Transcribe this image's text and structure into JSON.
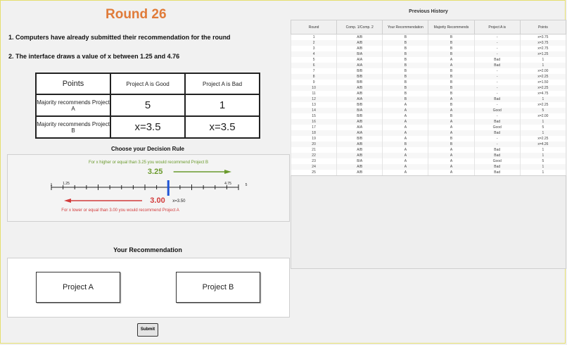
{
  "title": "Round   26",
  "instructions": [
    "1. Computers have already submitted their recommendation for the round",
    "2. The interface draws a value of x between 1.25 and 4.76"
  ],
  "points_table": {
    "header": [
      "Points",
      "Project A is Good",
      "Project A is Bad"
    ],
    "rows": [
      {
        "label": "Majority recommends Project A",
        "good": "5",
        "bad": "1"
      },
      {
        "label": "Majority recommends Project B",
        "good": "x=3.5",
        "bad": "x=3.5"
      }
    ]
  },
  "decision_rule": {
    "heading": "Choose your Decision Rule",
    "upper_text": "For x higher or equal than 3.25 you would recommend Project B",
    "lower_text": "For x lower or equal than 3.00 you would recommend Project A",
    "upper_value": "3.25",
    "lower_value": "3.00",
    "x_marker_label": "x=3.50",
    "tick_min": "1",
    "tick_low": "1.25",
    "tick_high": "4.75",
    "tick_max": "5",
    "axis_min": 1,
    "axis_max": 5,
    "upper_threshold": 3.25,
    "lower_threshold": 3.0,
    "x_value": 3.5,
    "colors": {
      "upper": "#6a9a2c",
      "lower": "#d23b3b",
      "marker": "#1f54d6"
    }
  },
  "recommendation": {
    "heading": "Your Recommendation",
    "option_a": "Project A",
    "option_b": "Project B"
  },
  "submit_label": "Submit",
  "history": {
    "title": "Previous History",
    "columns": [
      "Round",
      "Comp. 1/Comp. 2",
      "Your Recommendation",
      "Majority Recommends",
      "Project A is",
      "Points"
    ],
    "rows": [
      [
        "1",
        "A/B",
        "B",
        "B",
        "-",
        "x=3.75"
      ],
      [
        "2",
        "A/B",
        "B",
        "B",
        "-",
        "x=3.75"
      ],
      [
        "3",
        "A/B",
        "B",
        "B",
        "-",
        "x=2.75"
      ],
      [
        "4",
        "B/A",
        "B",
        "B",
        "-",
        "x=1.25"
      ],
      [
        "5",
        "A/A",
        "B",
        "A",
        "Bad",
        "1"
      ],
      [
        "6",
        "A/A",
        "B",
        "A",
        "Bad",
        "1"
      ],
      [
        "7",
        "B/B",
        "B",
        "B",
        "-",
        "x=2.00"
      ],
      [
        "8",
        "B/B",
        "B",
        "B",
        "-",
        "x=2.25"
      ],
      [
        "9",
        "B/B",
        "B",
        "B",
        "-",
        "x=1.50"
      ],
      [
        "10",
        "A/B",
        "B",
        "B",
        "-",
        "x=2.25"
      ],
      [
        "11",
        "A/B",
        "B",
        "B",
        "-",
        "x=4.75"
      ],
      [
        "12",
        "A/A",
        "B",
        "A",
        "Bad",
        "1"
      ],
      [
        "13",
        "B/B",
        "A",
        "B",
        "-",
        "x=2.25"
      ],
      [
        "14",
        "B/A",
        "A",
        "A",
        "Good",
        "5"
      ],
      [
        "15",
        "B/B",
        "A",
        "B",
        "-",
        "x=2.00"
      ],
      [
        "16",
        "A/B",
        "A",
        "A",
        "Bad",
        "1"
      ],
      [
        "17",
        "A/A",
        "A",
        "A",
        "Good",
        "5"
      ],
      [
        "18",
        "A/A",
        "A",
        "A",
        "Bad",
        "1"
      ],
      [
        "19",
        "B/B",
        "A",
        "B",
        "-",
        "x=2.25"
      ],
      [
        "20",
        "A/B",
        "B",
        "B",
        "-",
        "x=4.26"
      ],
      [
        "21",
        "A/B",
        "A",
        "A",
        "Bad",
        "1"
      ],
      [
        "22",
        "A/B",
        "A",
        "A",
        "Bad",
        "1"
      ],
      [
        "23",
        "B/A",
        "A",
        "A",
        "Good",
        "5"
      ],
      [
        "24",
        "A/B",
        "A",
        "A",
        "Bad",
        "1"
      ],
      [
        "25",
        "A/B",
        "A",
        "A",
        "Bad",
        "1"
      ]
    ]
  }
}
